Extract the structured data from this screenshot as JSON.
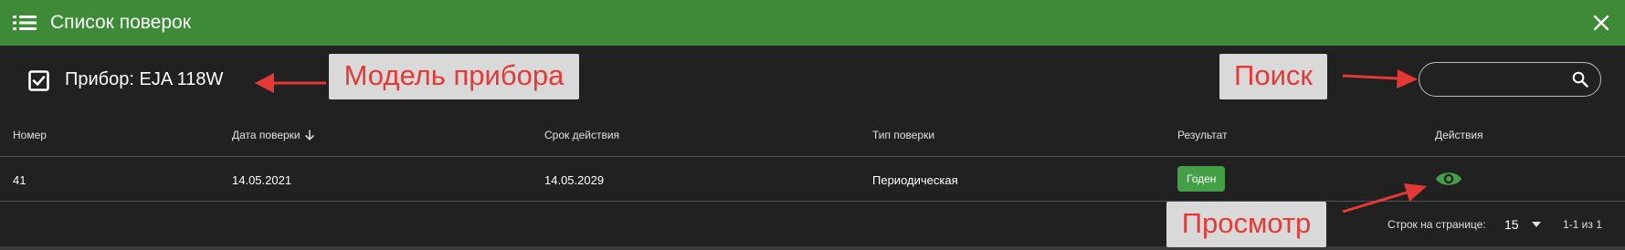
{
  "window": {
    "title": "Список поверок"
  },
  "device": {
    "label": "Прибор: EJA 118W"
  },
  "search": {
    "value": "",
    "placeholder": ""
  },
  "table": {
    "columns": [
      "Номер",
      "Дата поверки",
      "Срок действия",
      "Тип поверки",
      "Результат",
      "Действия"
    ],
    "sort_column": "Дата поверки",
    "sort_direction": "descending",
    "rows": [
      {
        "number": "41",
        "date": "14.05.2021",
        "expiry": "14.05.2029",
        "type": "Периодическая",
        "result": "Годен",
        "action_icon": "eye-icon"
      }
    ]
  },
  "pagination": {
    "rows_per_page_label": "Строк на странице:",
    "rows_per_page_value": "15",
    "range": "1-1 из 1"
  },
  "annotations": {
    "model": "Модель прибора",
    "search": "Поиск",
    "view": "Просмотр"
  },
  "colors": {
    "header": "#3d8b37",
    "background": "#212121",
    "badge": "#43a047",
    "view_icon": "#43a047",
    "annotation_text": "#e53935",
    "annotation_bg": "#d9d9d9"
  }
}
